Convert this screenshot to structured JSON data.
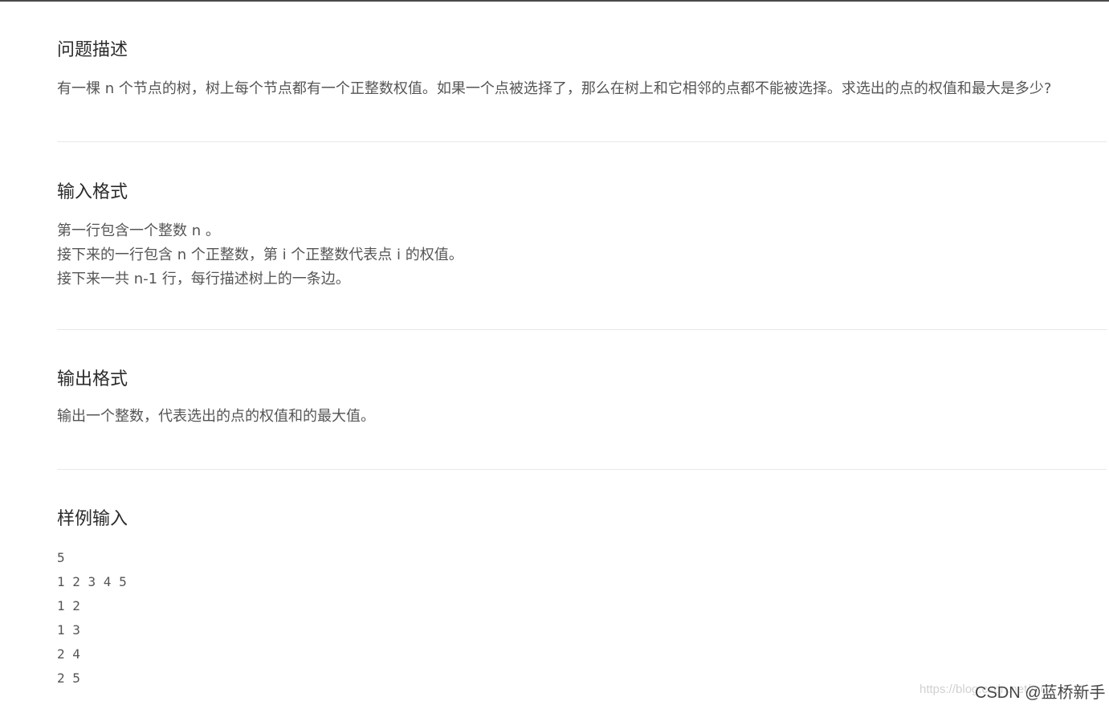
{
  "sections": {
    "description": {
      "title": "问题描述",
      "lines": [
        "有一棵 n 个节点的树，树上每个节点都有一个正整数权值。如果一个点被选择了，那么在树上和它相邻的点都不能被选择。求选出的点的权值和最大是多少?"
      ]
    },
    "input_format": {
      "title": "输入格式",
      "lines": [
        "第一行包含一个整数 n 。",
        "接下来的一行包含 n 个正整数，第 i 个正整数代表点 i 的权值。",
        "接下来一共 n-1 行，每行描述树上的一条边。"
      ]
    },
    "output_format": {
      "title": "输出格式",
      "lines": [
        "输出一个整数，代表选出的点的权值和的最大值。"
      ]
    },
    "sample_input": {
      "title": "样例输入",
      "lines": [
        "5",
        "1 2 3 4 5",
        "1 2",
        "1 3",
        "2 4",
        "2 5"
      ]
    }
  },
  "watermark": {
    "url": "https://blog.csdn.net/m0_",
    "brand": "CSDN @蓝桥新手"
  }
}
